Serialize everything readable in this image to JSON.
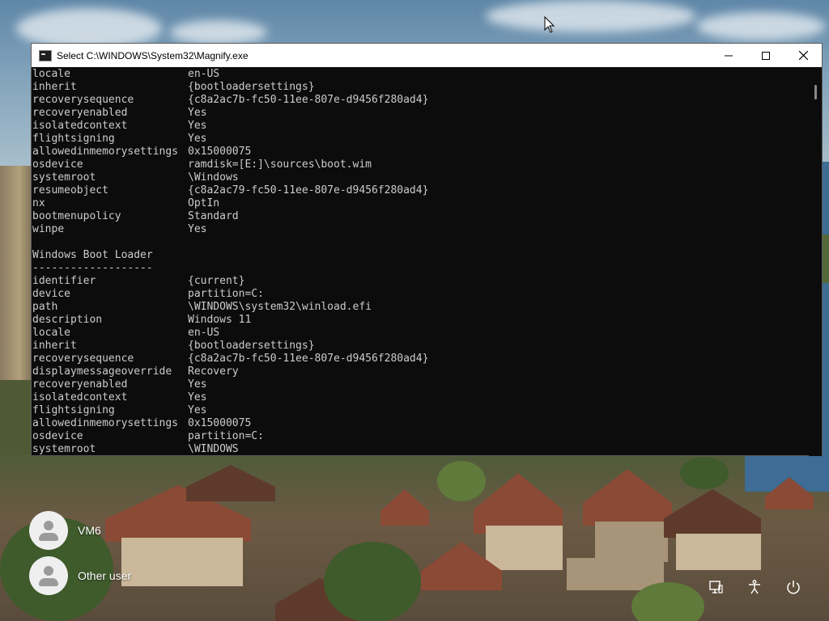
{
  "window": {
    "title": "Select C:\\WINDOWS\\System32\\Magnify.exe",
    "controls": {
      "minimize": "minimize",
      "maximize": "maximize",
      "close": "close"
    }
  },
  "console": {
    "lines": [
      {
        "k": "locale",
        "v": "en-US"
      },
      {
        "k": "inherit",
        "v": "{bootloadersettings}"
      },
      {
        "k": "recoverysequence",
        "v": "{c8a2ac7b-fc50-11ee-807e-d9456f280ad4}"
      },
      {
        "k": "recoveryenabled",
        "v": "Yes"
      },
      {
        "k": "isolatedcontext",
        "v": "Yes"
      },
      {
        "k": "flightsigning",
        "v": "Yes"
      },
      {
        "k": "allowedinmemorysettings",
        "v": "0x15000075"
      },
      {
        "k": "osdevice",
        "v": "ramdisk=[E:]\\sources\\boot.wim"
      },
      {
        "k": "systemroot",
        "v": "\\Windows"
      },
      {
        "k": "resumeobject",
        "v": "{c8a2ac79-fc50-11ee-807e-d9456f280ad4}"
      },
      {
        "k": "nx",
        "v": "OptIn"
      },
      {
        "k": "bootmenupolicy",
        "v": "Standard"
      },
      {
        "k": "winpe",
        "v": "Yes"
      },
      {
        "k": "",
        "v": ""
      },
      {
        "k": "Windows Boot Loader",
        "v": ""
      },
      {
        "k": "-------------------",
        "v": ""
      },
      {
        "k": "identifier",
        "v": "{current}"
      },
      {
        "k": "device",
        "v": "partition=C:"
      },
      {
        "k": "path",
        "v": "\\WINDOWS\\system32\\winload.efi"
      },
      {
        "k": "description",
        "v": "Windows 11"
      },
      {
        "k": "locale",
        "v": "en-US"
      },
      {
        "k": "inherit",
        "v": "{bootloadersettings}"
      },
      {
        "k": "recoverysequence",
        "v": "{c8a2ac7b-fc50-11ee-807e-d9456f280ad4}"
      },
      {
        "k": "displaymessageoverride",
        "v": "Recovery"
      },
      {
        "k": "recoveryenabled",
        "v": "Yes"
      },
      {
        "k": "isolatedcontext",
        "v": "Yes"
      },
      {
        "k": "flightsigning",
        "v": "Yes"
      },
      {
        "k": "allowedinmemorysettings",
        "v": "0x15000075"
      },
      {
        "k": "osdevice",
        "v": "partition=C:"
      },
      {
        "k": "systemroot",
        "v": "\\WINDOWS"
      }
    ]
  },
  "users": [
    {
      "name": "VM6"
    },
    {
      "name": "Other user"
    }
  ],
  "tray": {
    "icons": [
      "network-icon",
      "accessibility-icon",
      "power-icon"
    ]
  },
  "colors": {
    "console_bg": "#0c0c0c",
    "console_text": "#cccccc",
    "titlebar_bg": "#ffffff"
  }
}
